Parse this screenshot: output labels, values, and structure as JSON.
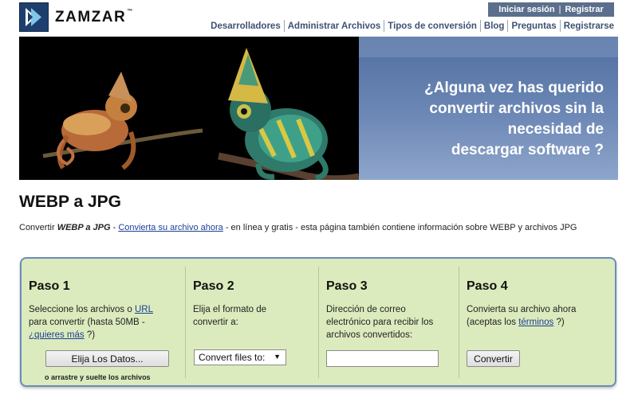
{
  "header": {
    "logo_text": "ZAMZAR",
    "logo_tm": "™",
    "auth": {
      "login": "Iniciar sesión",
      "separator": "|",
      "register": "Registrar"
    },
    "nav": [
      "Desarrolladores",
      "Administrar Archivos",
      "Tipos de conversión",
      "Blog",
      "Preguntas",
      "Registrarse"
    ]
  },
  "banner": {
    "lines": [
      "¿Alguna vez has querido",
      "convertir archivos sin la",
      "necesidad de",
      "descargar software ?"
    ]
  },
  "page": {
    "title": "WEBP a JPG",
    "desc_prefix": "Convertir ",
    "desc_em": "WEBP a JPG",
    "desc_dash": " - ",
    "desc_link": "Convierta su archivo ahora",
    "desc_suffix": " - en línea y gratis - esta página también contiene información sobre WEBP y archivos JPG"
  },
  "steps": {
    "s1": {
      "title": "Paso 1",
      "text_a": "Seleccione los archivos o ",
      "link_url": "URL",
      "text_b": "para convertir (hasta 50MB -",
      "link_more": "¿quieres más",
      "text_c": " ?)",
      "button": "Elija Los Datos...",
      "drag_note": "o arrastre y suelte los archivos"
    },
    "s2": {
      "title": "Paso 2",
      "text_a": "Elija el formato de",
      "text_b": "convertir a:",
      "select_value": "Convert files to:"
    },
    "s3": {
      "title": "Paso 3",
      "text_a": "Dirección de correo",
      "text_b": "electrónico para recibir los",
      "text_c": "archivos convertidos:",
      "email_value": ""
    },
    "s4": {
      "title": "Paso 4",
      "text_a": "Convierta su archivo ahora",
      "text_b": "(aceptas los ",
      "link_terms": "términos",
      "text_c": " ?)",
      "button": "Convertir"
    }
  },
  "colors": {
    "nav_text": "#3d5273",
    "auth_bg": "#5b6f8d",
    "panel_bg": "#dcebbd",
    "panel_border": "#6b8cba",
    "link": "#1c3f94"
  }
}
